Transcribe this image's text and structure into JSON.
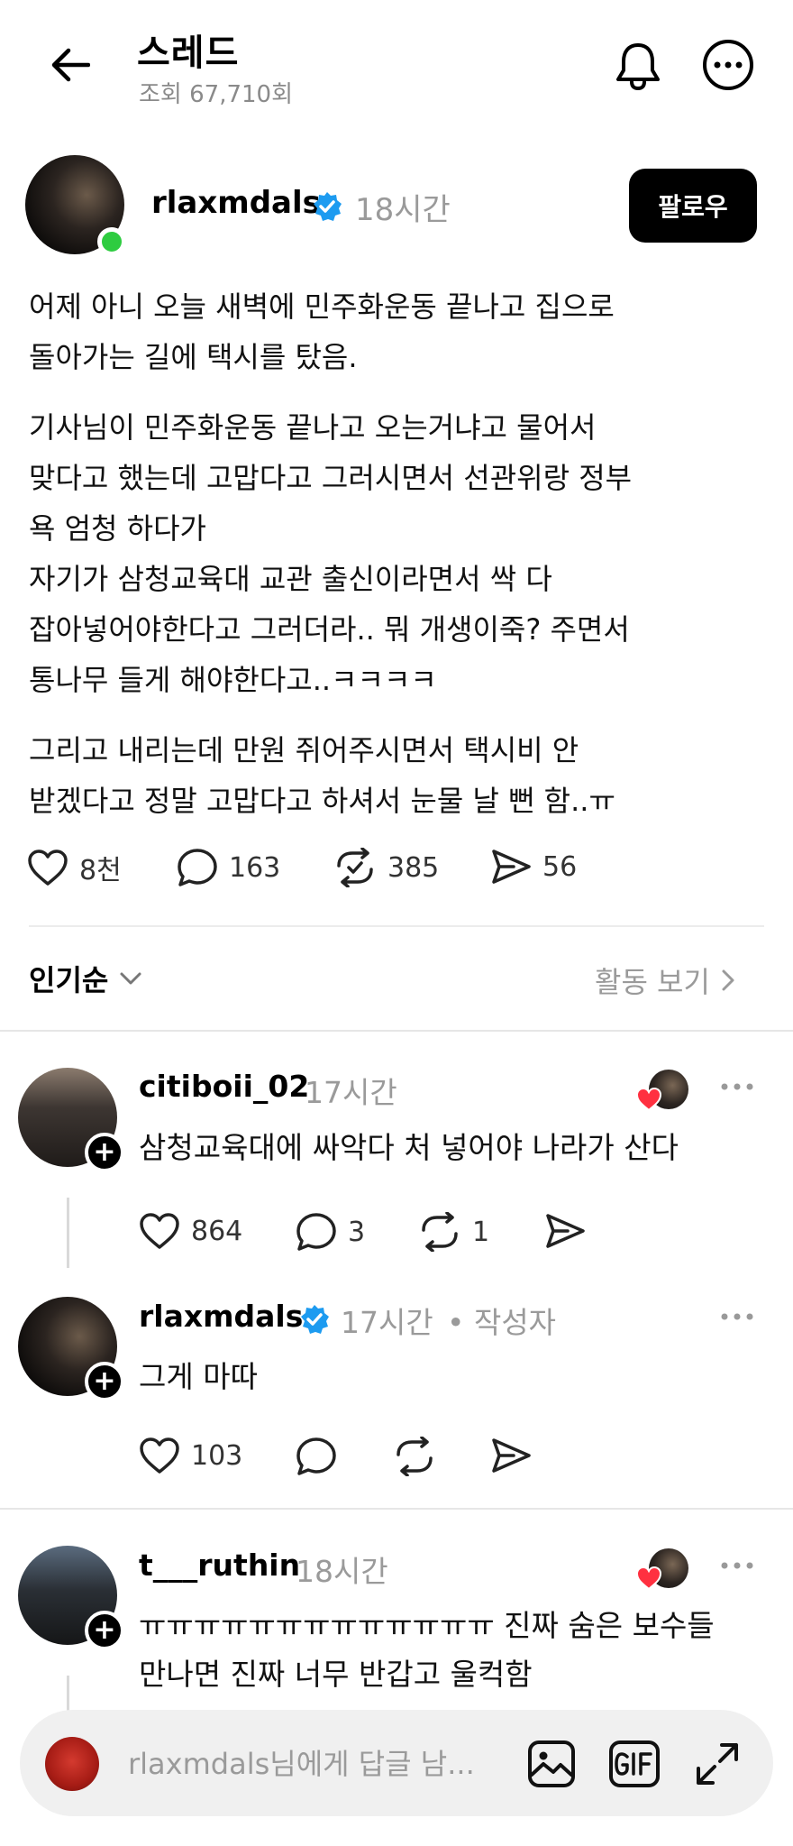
{
  "header": {
    "title": "스레드",
    "views": "조회 67,710회"
  },
  "post": {
    "author": "rlaxmdals",
    "time": "18시간",
    "follow_label": "팔로우",
    "paragraphs": [
      "어제 아니 오늘 새벽에 민주화운동 끝나고 집으로\n돌아가는 길에 택시를 탔음.",
      "기사님이 민주화운동 끝나고 오는거냐고 물어서\n맞다고 했는데 고맙다고 그러시면서 선관위랑 정부\n욕 엄청 하다가\n자기가 삼청교육대 교관 출신이라면서 싹 다\n잡아넣어야한다고 그러더라.. 뭐 개생이죽? 주면서\n통나무 들게 해야한다고..ㅋㅋㅋㅋ",
      "그리고 내리는데 만원 쥐어주시면서 택시비 안\n받겠다고 정말 고맙다고 하셔서 눈물 날 뻔 함..ㅠ"
    ],
    "stats": {
      "likes": "8천",
      "replies": "163",
      "reposts": "385",
      "shares": "56"
    }
  },
  "sort": {
    "label": "인기순",
    "activity_link": "활동 보기"
  },
  "comments": [
    {
      "author": "citiboii_02",
      "time": "17시간",
      "text": "삼청교육대에 싸악다 처 넣어야 나라가 산다",
      "likes": "864",
      "replies": "3",
      "reposts": "1"
    },
    {
      "author": "rlaxmdals",
      "time": "17시간",
      "author_tag": "• 작성자",
      "text": "그게 마따",
      "likes": "103"
    },
    {
      "author": "t___ruthin",
      "time": "18시간",
      "text": "ㅠㅠㅠㅠㅠㅠㅠㅠㅠㅠㅠㅠㅠ 진짜 숨은 보수들\n만나면 진짜 너무 반갑고 울컥함"
    }
  ],
  "reply_bar": {
    "placeholder": "rlaxmdals님에게 답글 남..."
  },
  "colors": {
    "verified_blue": "#1d9bf0",
    "online_green": "#2ecc40",
    "heart_red": "#ff3040"
  }
}
